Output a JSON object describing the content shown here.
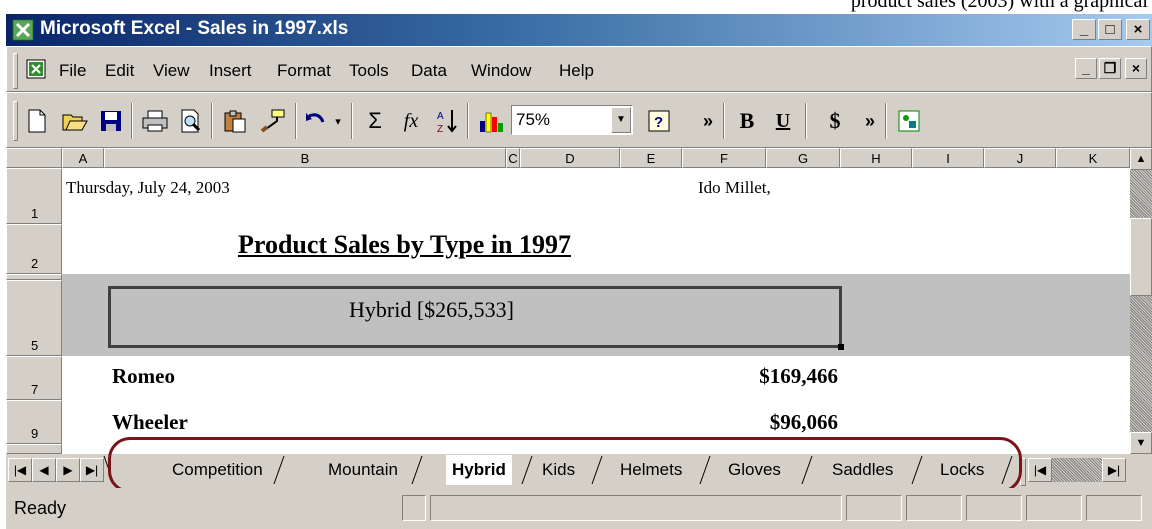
{
  "caption_fragment": "product sales (2003) with a graphical",
  "window": {
    "title": "Microsoft Excel - Sales in 1997.xls",
    "min_label": "_",
    "max_label": "□",
    "close_label": "×"
  },
  "menu": {
    "items": [
      "File",
      "Edit",
      "View",
      "Insert",
      "Format",
      "Tools",
      "Data",
      "Window",
      "Help"
    ],
    "mdi_min": "_",
    "mdi_restore": "❐",
    "mdi_close": "×"
  },
  "toolbar": {
    "zoom": "75%",
    "bold_label": "B",
    "underline_label": "U",
    "currency_label": "$",
    "sigma_label": "Σ",
    "fx_label": "fx",
    "more_label": "»"
  },
  "columns": [
    "A",
    "B",
    "C",
    "D",
    "E",
    "F",
    "G",
    "H",
    "I",
    "J",
    "K"
  ],
  "rows": [
    "1",
    "2",
    "5",
    "7",
    "9"
  ],
  "sheet": {
    "date": "Thursday, July 24, 2003",
    "author": "Ido Millet,",
    "title": "Product Sales by Type in 1997",
    "group_header": "Hybrid  [$265,533]",
    "lines": [
      {
        "product": "Romeo",
        "amount": "$169,466"
      },
      {
        "product": "Wheeler",
        "amount": "$96,066"
      }
    ]
  },
  "tabs": {
    "items": [
      "Competition",
      "Mountain",
      "Hybrid",
      "Kids",
      "Helmets",
      "Gloves",
      "Saddles",
      "Locks"
    ],
    "active": "Hybrid"
  },
  "status": {
    "text": "Ready"
  },
  "colors": {
    "title_gradient_start": "#0a246a",
    "title_gradient_end": "#a6caf0",
    "chrome": "#d4d0c8",
    "highlight_ring": "#7b1416",
    "group_band": "#c0c0c0"
  },
  "icons": [
    "excel-app-icon",
    "workbook-icon",
    "new-icon",
    "open-icon",
    "save-icon",
    "print-icon",
    "print-preview-icon",
    "paste-icon",
    "format-painter-icon",
    "undo-icon",
    "autosum-icon",
    "function-icon",
    "sort-ascending-icon",
    "chart-wizard-icon",
    "help-icon"
  ]
}
